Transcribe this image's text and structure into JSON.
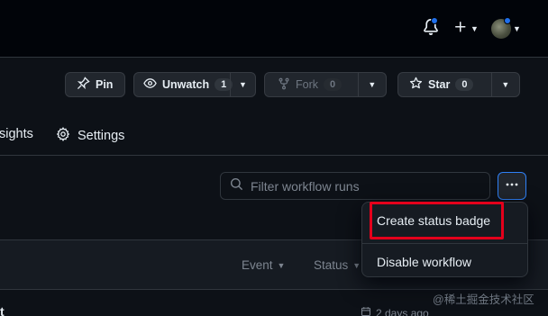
{
  "header": {
    "icons": [
      "bell-icon",
      "plus-icon",
      "avatar"
    ],
    "notification_dot_color": "#1f6feb"
  },
  "repo_actions": {
    "pin": {
      "label": "Pin"
    },
    "unwatch": {
      "label": "Unwatch",
      "count": "1"
    },
    "fork": {
      "label": "Fork",
      "count": "0"
    },
    "star": {
      "label": "Star",
      "count": "0"
    }
  },
  "tabs": {
    "insights": "sights",
    "settings": "Settings"
  },
  "workflow_runs": {
    "filter_placeholder": "Filter workflow runs",
    "table_headers": {
      "event": "Event",
      "status": "Status"
    },
    "first_row": {
      "title_fragment": "t",
      "time": "2 days ago"
    }
  },
  "dropdown_menu": {
    "items": [
      "Create status badge",
      "Disable workflow"
    ],
    "highlighted_item": "Create status badge",
    "highlight_color": "#e4001b"
  },
  "watermark": "@稀土掘金技术社区"
}
